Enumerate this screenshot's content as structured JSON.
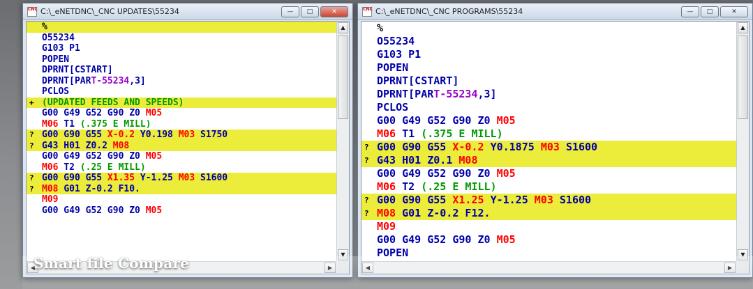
{
  "colors": {
    "highlight": "#ecec3a",
    "code_blue": "#0000aa",
    "code_red": "#ff0000",
    "code_purple": "#9900cc",
    "code_green": "#009900"
  },
  "left_window": {
    "title": "C:\\_eNETDNC\\_CNC UPDATES\\55234",
    "icon": "app-icon",
    "lines": [
      {
        "marker": "",
        "hl": true,
        "segments": [
          {
            "text": "%",
            "c": "#000000"
          }
        ]
      },
      {
        "marker": "",
        "hl": false,
        "segments": [
          {
            "text": "O55234",
            "c": "#0000aa"
          }
        ]
      },
      {
        "marker": "",
        "hl": false,
        "segments": [
          {
            "text": "G103 P1",
            "c": "#0000aa"
          }
        ]
      },
      {
        "marker": "",
        "hl": false,
        "segments": [
          {
            "text": "POPEN",
            "c": "#0000aa"
          }
        ]
      },
      {
        "marker": "",
        "hl": false,
        "segments": [
          {
            "text": "DPRNT[CSTART]",
            "c": "#0000aa"
          }
        ]
      },
      {
        "marker": "",
        "hl": false,
        "segments": [
          {
            "text": "DPRNT[PAR",
            "c": "#0000aa"
          },
          {
            "text": "T-55234",
            "c": "#9900cc"
          },
          {
            "text": ",3]",
            "c": "#0000aa"
          }
        ]
      },
      {
        "marker": "",
        "hl": false,
        "segments": [
          {
            "text": "PCLOS",
            "c": "#0000aa"
          }
        ]
      },
      {
        "marker": "+",
        "hl": true,
        "segments": [
          {
            "text": "(UPDATED FEEDS AND SPEEDS)",
            "c": "#009900"
          }
        ]
      },
      {
        "marker": "",
        "hl": false,
        "segments": [
          {
            "text": "G00 G49 G52 G90 Z0 ",
            "c": "#0000aa"
          },
          {
            "text": "M05",
            "c": "#ff0000"
          }
        ]
      },
      {
        "marker": "",
        "hl": false,
        "segments": [
          {
            "text": "M06 ",
            "c": "#ff0000"
          },
          {
            "text": "T1 ",
            "c": "#0000aa"
          },
          {
            "text": "(.375 E MILL)",
            "c": "#009900"
          }
        ]
      },
      {
        "marker": "?",
        "hl": true,
        "segments": [
          {
            "text": "G00 G90 G55 ",
            "c": "#0000aa"
          },
          {
            "text": "X-0.2 ",
            "c": "#ff0000"
          },
          {
            "text": "Y0.198 ",
            "c": "#0000aa"
          },
          {
            "text": "M03 ",
            "c": "#ff0000"
          },
          {
            "text": "S1750",
            "c": "#0000aa"
          }
        ]
      },
      {
        "marker": "?",
        "hl": true,
        "segments": [
          {
            "text": "G43 H01 Z0.2 ",
            "c": "#0000aa"
          },
          {
            "text": "M08",
            "c": "#ff0000"
          }
        ]
      },
      {
        "marker": "",
        "hl": false,
        "segments": [
          {
            "text": "G00 G49 G52 G90 Z0 ",
            "c": "#0000aa"
          },
          {
            "text": "M05",
            "c": "#ff0000"
          }
        ]
      },
      {
        "marker": "",
        "hl": false,
        "segments": [
          {
            "text": "M06 ",
            "c": "#ff0000"
          },
          {
            "text": "T2 ",
            "c": "#0000aa"
          },
          {
            "text": "(.25 E MILL)",
            "c": "#009900"
          }
        ]
      },
      {
        "marker": "?",
        "hl": true,
        "segments": [
          {
            "text": "G00 G90 G55 ",
            "c": "#0000aa"
          },
          {
            "text": "X1.35 ",
            "c": "#ff0000"
          },
          {
            "text": "Y-1.25 ",
            "c": "#0000aa"
          },
          {
            "text": "M03 ",
            "c": "#ff0000"
          },
          {
            "text": "S1600",
            "c": "#0000aa"
          }
        ]
      },
      {
        "marker": "?",
        "hl": true,
        "segments": [
          {
            "text": "M08 ",
            "c": "#ff0000"
          },
          {
            "text": "G01 Z-0.2 F10.",
            "c": "#0000aa"
          }
        ]
      },
      {
        "marker": "",
        "hl": false,
        "segments": [
          {
            "text": "M09",
            "c": "#ff0000"
          }
        ]
      },
      {
        "marker": "",
        "hl": false,
        "segments": [
          {
            "text": "G00 G49 G52 G90 Z0 ",
            "c": "#0000aa"
          },
          {
            "text": "M05",
            "c": "#ff0000"
          }
        ]
      }
    ]
  },
  "right_window": {
    "title": "C:\\_eNETDNC\\_CNC PROGRAMS\\55234",
    "icon": "app-icon",
    "lines": [
      {
        "marker": "",
        "hl": false,
        "segments": [
          {
            "text": "%",
            "c": "#000000"
          }
        ]
      },
      {
        "marker": "",
        "hl": false,
        "segments": [
          {
            "text": "O55234",
            "c": "#0000aa"
          }
        ]
      },
      {
        "marker": "",
        "hl": false,
        "segments": [
          {
            "text": "G103 P1",
            "c": "#0000aa"
          }
        ]
      },
      {
        "marker": "",
        "hl": false,
        "segments": [
          {
            "text": "POPEN",
            "c": "#0000aa"
          }
        ]
      },
      {
        "marker": "",
        "hl": false,
        "segments": [
          {
            "text": "DPRNT[CSTART]",
            "c": "#0000aa"
          }
        ]
      },
      {
        "marker": "",
        "hl": false,
        "segments": [
          {
            "text": "DPRNT[PAR",
            "c": "#0000aa"
          },
          {
            "text": "T-55234",
            "c": "#9900cc"
          },
          {
            "text": ",3]",
            "c": "#0000aa"
          }
        ]
      },
      {
        "marker": "",
        "hl": false,
        "segments": [
          {
            "text": "PCLOS",
            "c": "#0000aa"
          }
        ]
      },
      {
        "marker": "",
        "hl": false,
        "segments": [
          {
            "text": "G00 G49 G52 G90 Z0 ",
            "c": "#0000aa"
          },
          {
            "text": "M05",
            "c": "#ff0000"
          }
        ]
      },
      {
        "marker": "",
        "hl": false,
        "segments": [
          {
            "text": "M06 ",
            "c": "#ff0000"
          },
          {
            "text": "T1 ",
            "c": "#0000aa"
          },
          {
            "text": "(.375 E MILL)",
            "c": "#009900"
          }
        ]
      },
      {
        "marker": "?",
        "hl": true,
        "segments": [
          {
            "text": "G00 G90 G55 ",
            "c": "#0000aa"
          },
          {
            "text": "X-0.2 ",
            "c": "#ff0000"
          },
          {
            "text": "Y0.1875 ",
            "c": "#0000aa"
          },
          {
            "text": "M03 ",
            "c": "#ff0000"
          },
          {
            "text": "S1600",
            "c": "#0000aa"
          }
        ]
      },
      {
        "marker": "?",
        "hl": true,
        "segments": [
          {
            "text": "G43 H01 Z0.1 ",
            "c": "#0000aa"
          },
          {
            "text": "M08",
            "c": "#ff0000"
          }
        ]
      },
      {
        "marker": "",
        "hl": false,
        "segments": [
          {
            "text": "G00 G49 G52 G90 Z0 ",
            "c": "#0000aa"
          },
          {
            "text": "M05",
            "c": "#ff0000"
          }
        ]
      },
      {
        "marker": "",
        "hl": false,
        "segments": [
          {
            "text": "M06 ",
            "c": "#ff0000"
          },
          {
            "text": "T2 ",
            "c": "#0000aa"
          },
          {
            "text": "(.25 E MILL)",
            "c": "#009900"
          }
        ]
      },
      {
        "marker": "?",
        "hl": true,
        "segments": [
          {
            "text": "G00 G90 G55 ",
            "c": "#0000aa"
          },
          {
            "text": "X1.25 ",
            "c": "#ff0000"
          },
          {
            "text": "Y-1.25 ",
            "c": "#0000aa"
          },
          {
            "text": "M03 ",
            "c": "#ff0000"
          },
          {
            "text": "S1600",
            "c": "#0000aa"
          }
        ]
      },
      {
        "marker": "?",
        "hl": true,
        "segments": [
          {
            "text": "M08 ",
            "c": "#ff0000"
          },
          {
            "text": "G01 Z-0.2 F12.",
            "c": "#0000aa"
          }
        ]
      },
      {
        "marker": "",
        "hl": false,
        "segments": [
          {
            "text": "M09",
            "c": "#ff0000"
          }
        ]
      },
      {
        "marker": "",
        "hl": false,
        "segments": [
          {
            "text": "G00 G49 G52 G90 Z0 ",
            "c": "#0000aa"
          },
          {
            "text": "M05",
            "c": "#ff0000"
          }
        ]
      },
      {
        "marker": "",
        "hl": false,
        "segments": [
          {
            "text": "POPEN",
            "c": "#0000aa"
          }
        ]
      }
    ]
  },
  "caption": "Smart file Compare"
}
